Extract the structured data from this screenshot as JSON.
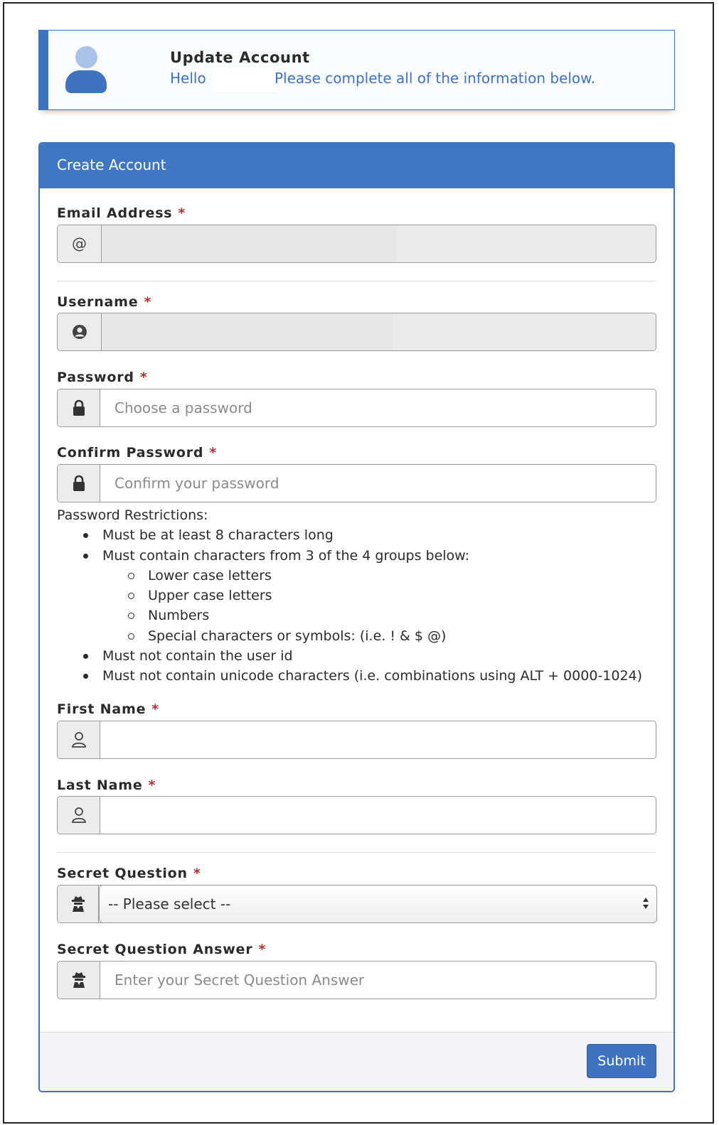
{
  "banner": {
    "title": "Update Account",
    "hello": "Hello",
    "message": "Please complete all of the information below."
  },
  "card": {
    "header": "Create Account",
    "submit_label": "Submit"
  },
  "fields": {
    "email": {
      "label": "Email Address",
      "required": "*",
      "addon": "@"
    },
    "username": {
      "label": "Username",
      "required": "*"
    },
    "password": {
      "label": "Password",
      "required": "*",
      "placeholder": "Choose a password"
    },
    "confirm_password": {
      "label": "Confirm Password",
      "required": "*",
      "placeholder": "Confirm your password"
    },
    "first_name": {
      "label": "First Name",
      "required": "*"
    },
    "last_name": {
      "label": "Last Name",
      "required": "*"
    },
    "secret_question": {
      "label": "Secret Question",
      "required": "*",
      "selected": "-- Please select --"
    },
    "secret_answer": {
      "label": "Secret Question Answer",
      "required": "*",
      "placeholder": "Enter your Secret Question Answer"
    }
  },
  "restrictions": {
    "title": "Password Restrictions:",
    "items": [
      "Must be at least 8 characters long",
      "Must contain characters from 3 of the 4 groups below:",
      "Must not contain the user id",
      "Must not contain unicode characters (i.e. combinations using ALT + 0000-1024)"
    ],
    "groups": [
      "Lower case letters",
      "Upper case letters",
      "Numbers",
      "Special characters or symbols: (i.e. ! & $ @)"
    ]
  },
  "colors": {
    "accent": "#3f72bf",
    "header_bg": "#4176c2",
    "required": "#b03030"
  }
}
